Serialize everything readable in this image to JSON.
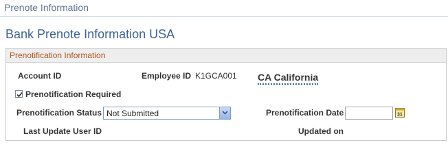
{
  "page_header": {
    "title": "Prenote Information"
  },
  "page_title": "Bank Prenote Information USA",
  "group": {
    "title": "Prenotification Information",
    "account_id_label": "Account ID",
    "employee_id_label": "Employee ID",
    "employee_id_value": "K1GCA001",
    "state_value": "CA California",
    "prenotification_required_label": "Prenotification Required",
    "prenotification_required_checked": true,
    "prenotification_status_label": "Prenotification Status",
    "prenotification_status_value": "Not Submitted",
    "prenotification_date_label": "Prenotification Date",
    "prenotification_date_value": "",
    "last_update_user_label": "Last Update User ID",
    "updated_on_label": "Updated on"
  },
  "icons": {
    "checkbox_check": "check-icon",
    "select_arrow": "chevron-down-icon",
    "calendar": "calendar-icon"
  },
  "colors": {
    "header_title": "#5e7696",
    "page_title": "#3d6296",
    "group_title": "#b05323",
    "group_header_bg": "#eeeeee"
  }
}
